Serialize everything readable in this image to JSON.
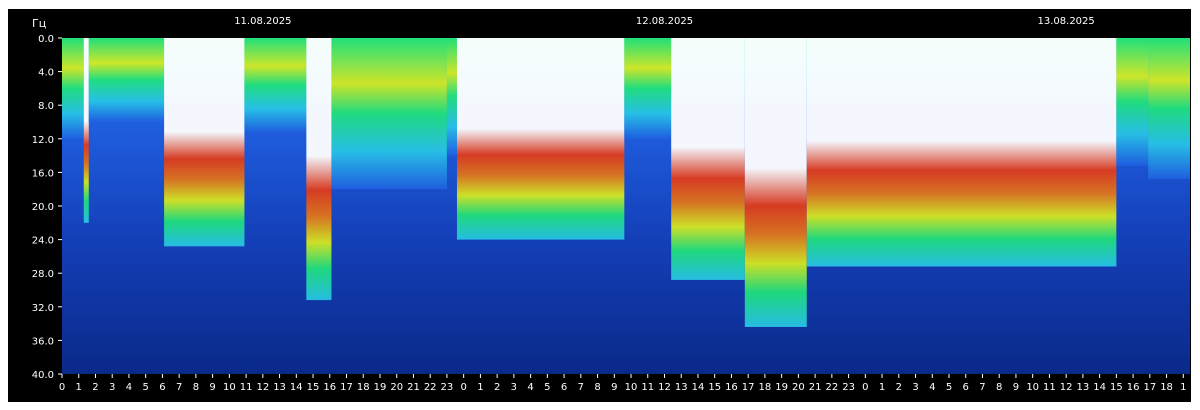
{
  "chart_data": {
    "type": "heatmap",
    "y_unit_label": "Гц",
    "date_labels": [
      {
        "text": "11.08.2025",
        "hour": 12
      },
      {
        "text": "12.08.2025",
        "hour": 36
      },
      {
        "text": "13.08.2025",
        "hour": 60
      }
    ],
    "y_ticks": [
      "0.0",
      "4.0",
      "8.0",
      "12.0",
      "16.0",
      "20.0",
      "24.0",
      "28.0",
      "32.0",
      "36.0",
      "40.0"
    ],
    "y_range": [
      0,
      40
    ],
    "x_ticks": [
      "0",
      "1",
      "2",
      "3",
      "4",
      "5",
      "6",
      "7",
      "8",
      "9",
      "10",
      "11",
      "12",
      "13",
      "14",
      "15",
      "16",
      "17",
      "18",
      "19",
      "20",
      "21",
      "22",
      "23",
      "0",
      "1",
      "2",
      "3",
      "4",
      "5",
      "6",
      "7",
      "8",
      "9",
      "10",
      "11",
      "12",
      "13",
      "14",
      "15",
      "16",
      "17",
      "18",
      "19",
      "20",
      "21",
      "22",
      "23",
      "0",
      "1",
      "2",
      "3",
      "4",
      "5",
      "6",
      "7",
      "8",
      "9",
      "10",
      "11",
      "12",
      "13",
      "14",
      "15",
      "16",
      "17",
      "18",
      "1"
    ],
    "x_range_hours": [
      0,
      67.4
    ],
    "colorscale": [
      "#0a2a8a",
      "#1f5fe0",
      "#27c3e6",
      "#1fe07a",
      "#d6e81f",
      "#e0751a",
      "#e03a1a",
      "#ffffff"
    ],
    "activity_segments": [
      {
        "start": 0.0,
        "end": 1.3,
        "level": 0.3
      },
      {
        "start": 1.3,
        "end": 1.6,
        "level": 0.55
      },
      {
        "start": 1.6,
        "end": 6.1,
        "level": 0.25
      },
      {
        "start": 6.1,
        "end": 10.9,
        "level": 0.62
      },
      {
        "start": 10.9,
        "end": 14.6,
        "level": 0.28
      },
      {
        "start": 14.6,
        "end": 16.1,
        "level": 0.78
      },
      {
        "start": 16.1,
        "end": 23.0,
        "level": 0.45
      },
      {
        "start": 23.0,
        "end": 23.6,
        "level": 0.35
      },
      {
        "start": 23.6,
        "end": 33.6,
        "level": 0.6
      },
      {
        "start": 33.6,
        "end": 36.4,
        "level": 0.3
      },
      {
        "start": 36.4,
        "end": 40.8,
        "level": 0.72
      },
      {
        "start": 40.8,
        "end": 44.5,
        "level": 0.86
      },
      {
        "start": 44.5,
        "end": 63.0,
        "level": 0.68
      },
      {
        "start": 63.0,
        "end": 64.9,
        "level": 0.38
      },
      {
        "start": 64.9,
        "end": 67.4,
        "level": 0.42
      }
    ]
  }
}
